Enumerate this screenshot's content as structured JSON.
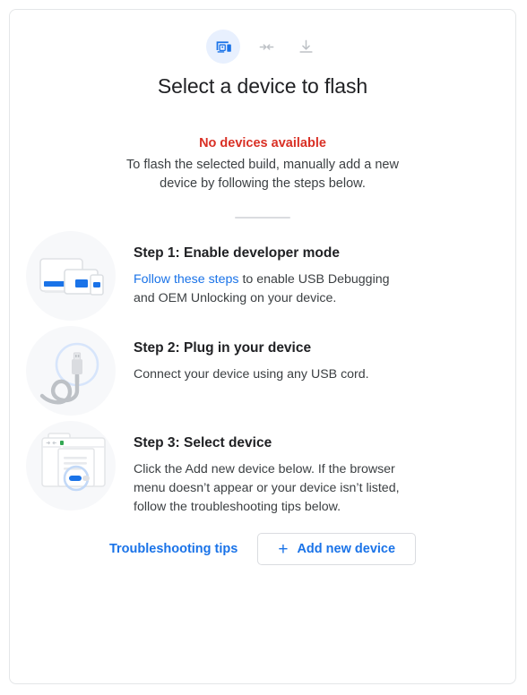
{
  "header": {
    "icons": [
      {
        "name": "devices-icon",
        "state": "active"
      },
      {
        "name": "merge-arrows-icon",
        "state": "inactive"
      },
      {
        "name": "download-icon",
        "state": "inactive"
      }
    ],
    "title": "Select a device to flash"
  },
  "status": {
    "error": "No devices available",
    "description": "To flash the selected build, manually add a new device by following the steps below."
  },
  "steps": [
    {
      "art": "devices-illustration",
      "title": "Step 1: Enable developer mode",
      "link_label": "Follow these steps",
      "text_after_link": " to enable USB Debugging and OEM Unlocking on your device."
    },
    {
      "art": "usb-cable-illustration",
      "title": "Step 2: Plug in your device",
      "text": "Connect your device using any USB cord."
    },
    {
      "art": "browser-dialog-illustration",
      "title": "Step 3: Select device",
      "text": "Click the Add new device below. If the browser menu doesn’t appear or your device isn’t listed, follow the troubleshooting tips below."
    }
  ],
  "footer": {
    "troubleshooting_label": "Troubleshooting tips",
    "add_device_label": "Add new device",
    "add_device_plus": "+"
  },
  "colors": {
    "accent_blue": "#1a73e8",
    "error_red": "#d93025",
    "icon_bg": "#e8f0fe",
    "art_bg": "#f7f8fa",
    "text_primary": "#202124",
    "text_secondary": "#3c4043",
    "border": "#dadce0"
  }
}
